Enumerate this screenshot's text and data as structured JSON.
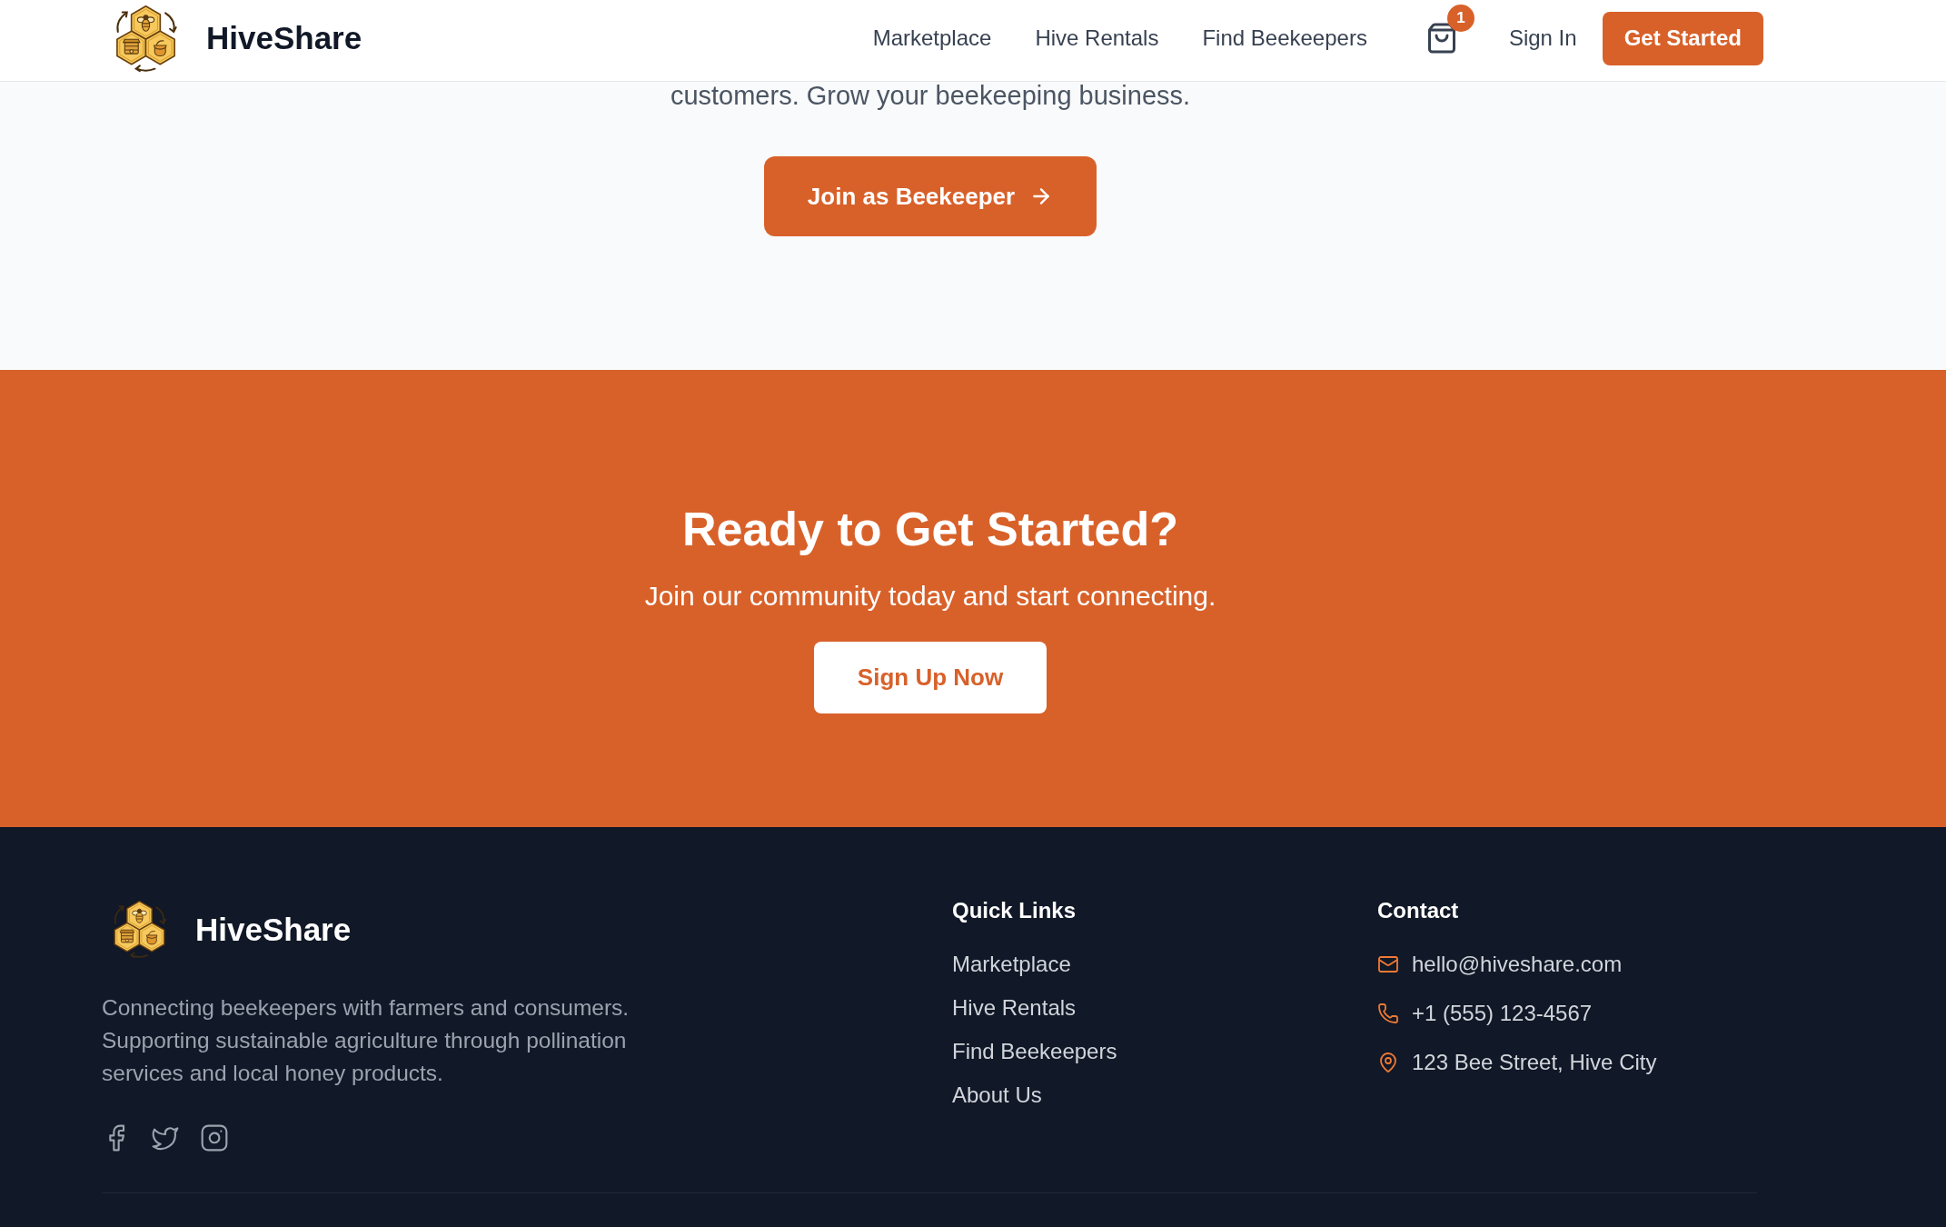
{
  "header": {
    "brand": "HiveShare",
    "nav": [
      "Marketplace",
      "Hive Rentals",
      "Find Beekeepers"
    ],
    "cart_count": "1",
    "sign_in": "Sign In",
    "cta": "Get Started"
  },
  "intro": {
    "text": "customers. Grow your beekeeping business.",
    "button": "Join as Beekeeper"
  },
  "cta_banner": {
    "title": "Ready to Get Started?",
    "subtitle": "Join our community today and start connecting.",
    "button": "Sign Up Now"
  },
  "footer": {
    "brand": "HiveShare",
    "description": "Connecting beekeepers with farmers and consumers. Supporting sustainable agriculture through pollination services and local honey products.",
    "quick_links": {
      "title": "Quick Links",
      "links": [
        "Marketplace",
        "Hive Rentals",
        "Find Beekeepers",
        "About Us"
      ]
    },
    "contact": {
      "title": "Contact",
      "items": [
        {
          "kind": "email",
          "text": "hello@hiveshare.com"
        },
        {
          "kind": "phone",
          "text": "+1 (555) 123-4567"
        },
        {
          "kind": "address",
          "text": "123 Bee Street, Hive City"
        }
      ]
    }
  }
}
